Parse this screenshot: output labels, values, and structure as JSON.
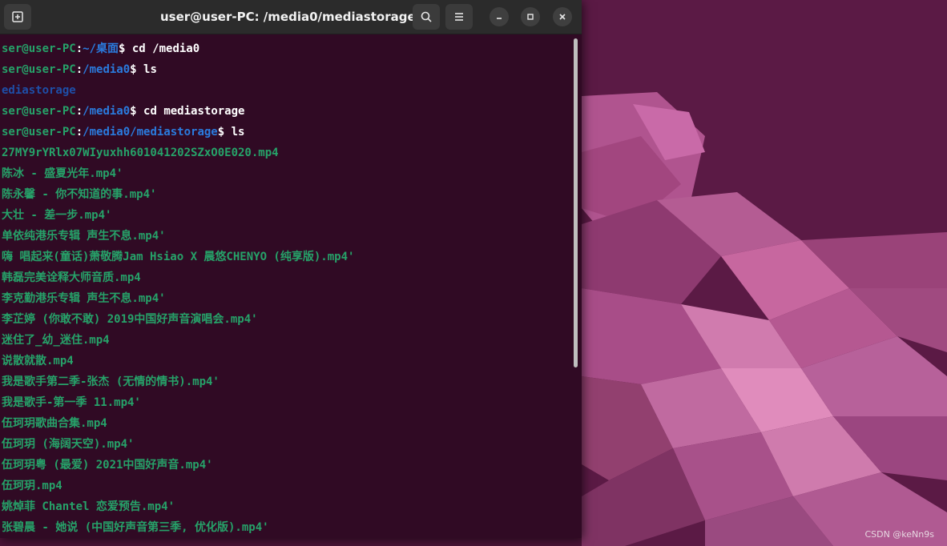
{
  "window": {
    "title": "user@user-PC: /media0/mediastorage"
  },
  "icons": {
    "new_tab": "new-tab-icon",
    "search": "search-icon",
    "menu": "hamburger-menu-icon",
    "minimize": "minimize-icon",
    "maximize": "maximize-icon",
    "close": "close-icon"
  },
  "colors": {
    "terminal_bg": "#300a24",
    "prompt_user": "#26a269",
    "prompt_path": "#2a7bde",
    "directory": "#1e4fa8",
    "file": "#26a269"
  },
  "terminal": {
    "lines": [
      {
        "user": "ser@user-PC",
        "sep": ":",
        "path": "~/桌面",
        "cmd": "$ cd /media0"
      },
      {
        "user": "ser@user-PC",
        "sep": ":",
        "path": "/media0",
        "cmd": "$ ls"
      },
      {
        "dir": "ediastorage"
      },
      {
        "user": "ser@user-PC",
        "sep": ":",
        "path": "/media0",
        "cmd": "$ cd mediastorage"
      },
      {
        "user": "ser@user-PC",
        "sep": ":",
        "path": "/media0/mediastorage",
        "cmd": "$ ls"
      },
      {
        "file": "27MY9rYRlx07WIyuxhh601041202SZxO0E020.mp4"
      },
      {
        "file": "陈冰 - 盛夏光年.mp4'"
      },
      {
        "file": "陈永馨 - 你不知道的事.mp4'"
      },
      {
        "file": "大壮 - 差一步.mp4'"
      },
      {
        "file": "单依纯港乐专辑 声生不息.mp4'"
      },
      {
        "file": "嗨 唱起来(童话)萧敬腾Jam Hsiao X 晨悠CHENYO (纯享版).mp4'"
      },
      {
        "file": "韩磊完美诠释大师音质.mp4"
      },
      {
        "file": "李克勤港乐专辑 声生不息.mp4'"
      },
      {
        "file": "李芷婷 (你敢不敢) 2019中国好声音演唱会.mp4'"
      },
      {
        "file": "迷住了_幼_迷住.mp4"
      },
      {
        "file": "说散就散.mp4"
      },
      {
        "file": "我是歌手第二季-张杰 (无情的情书).mp4'"
      },
      {
        "file": "我是歌手-第一季 11.mp4'"
      },
      {
        "file": "伍珂玥歌曲合集.mp4"
      },
      {
        "file": "伍珂玥 (海阔天空).mp4'"
      },
      {
        "file": "伍珂玥粤 (最爱) 2021中国好声音.mp4'"
      },
      {
        "file": "伍珂玥.mp4"
      },
      {
        "file": "姚焯菲 Chantel 恋爱预告.mp4'"
      },
      {
        "file": "张碧晨 - 她说 (中国好声音第三季, 优化版).mp4'"
      }
    ]
  },
  "watermark": "CSDN @keNn9s"
}
